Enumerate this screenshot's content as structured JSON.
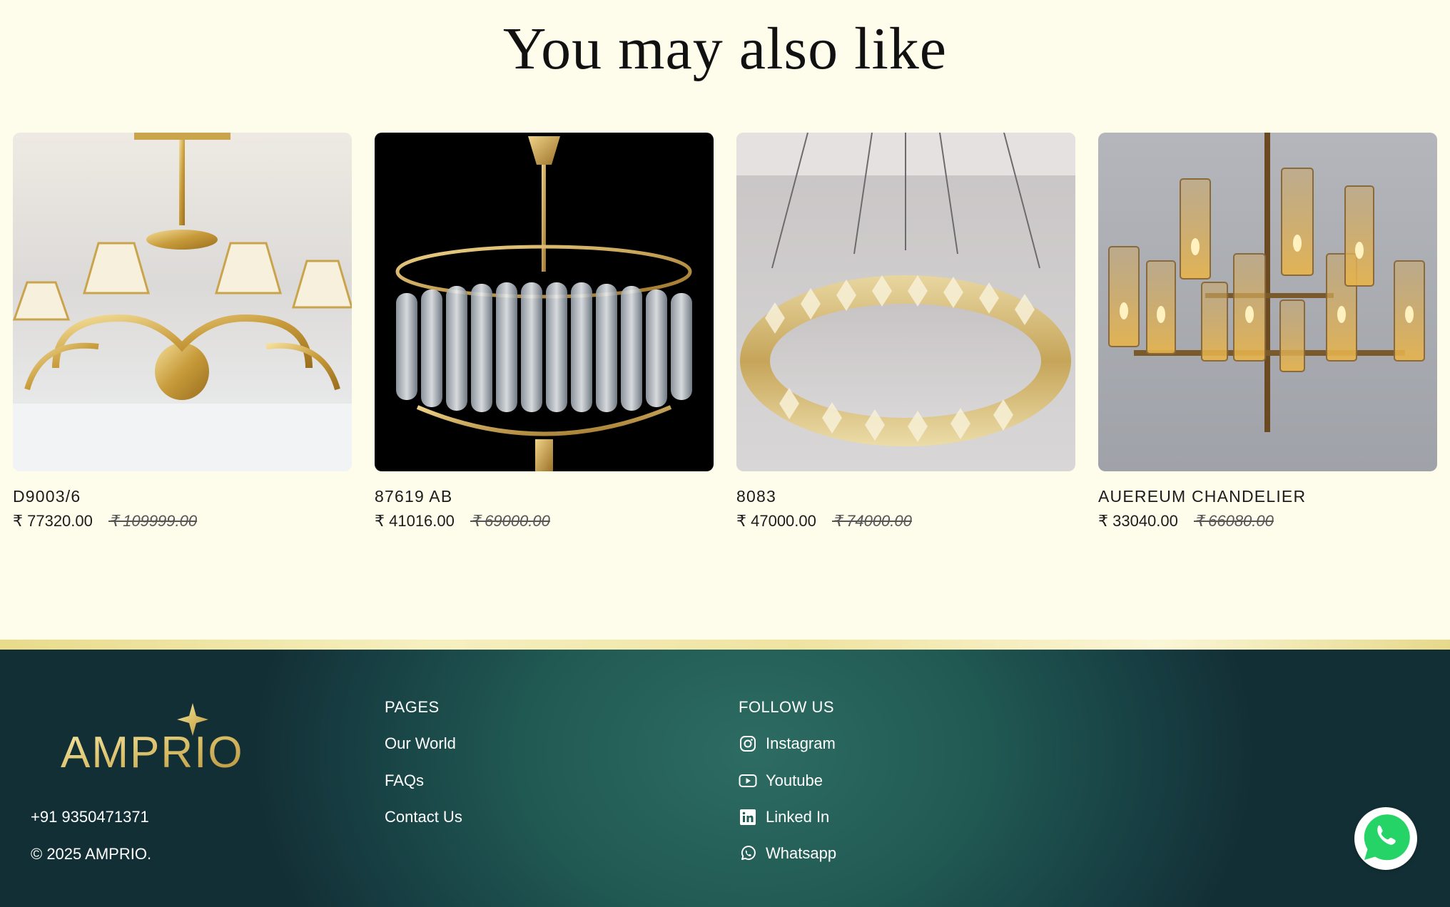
{
  "section": {
    "title": "You may also like"
  },
  "products": [
    {
      "name": "D9003/6",
      "price": "₹ 77320.00",
      "compare_price": "₹ 109999.00"
    },
    {
      "name": "87619 AB",
      "price": "₹ 41016.00",
      "compare_price": "₹ 69000.00"
    },
    {
      "name": "8083",
      "price": "₹ 47000.00",
      "compare_price": "₹ 74000.00"
    },
    {
      "name": "AUEREUM CHANDELIER",
      "price": "₹ 33040.00",
      "compare_price": "₹ 66080.00"
    }
  ],
  "footer": {
    "brand": "AMPRIO",
    "phone": "+91 9350471371",
    "copyright": "© 2025 AMPRIO.",
    "pages_heading": "PAGES",
    "pages": [
      "Our World",
      "FAQs",
      "Contact Us"
    ],
    "follow_heading": "FOLLOW US",
    "social": [
      {
        "label": "Instagram",
        "icon": "instagram-icon"
      },
      {
        "label": "Youtube",
        "icon": "youtube-icon"
      },
      {
        "label": "Linked In",
        "icon": "linkedin-icon"
      },
      {
        "label": "Whatsapp",
        "icon": "whatsapp-icon"
      }
    ],
    "floating_button_icon": "whatsapp-icon"
  },
  "colors": {
    "page_bg": "#fefdec",
    "footer_bg": "#215a53",
    "gold": "#d9c06a",
    "whatsapp_green": "#25d366"
  }
}
